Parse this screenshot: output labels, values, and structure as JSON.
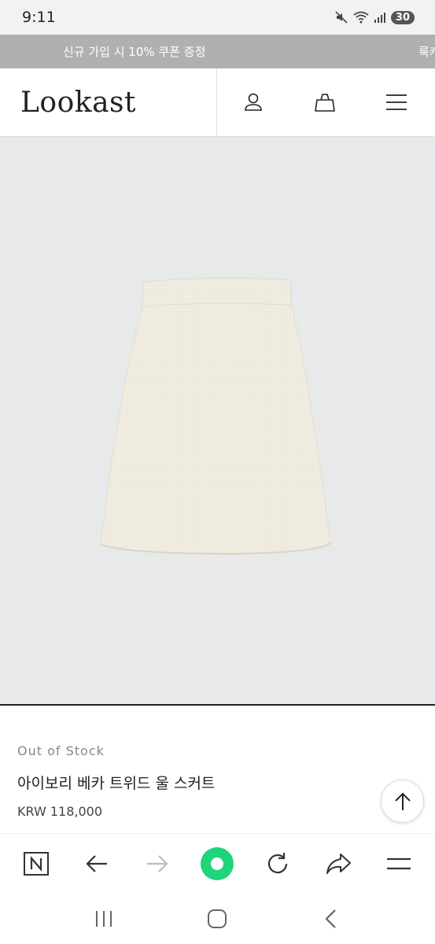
{
  "status_bar": {
    "time": "9:11",
    "battery": "30"
  },
  "promo": {
    "text": "신규 가입 시 10% 쿠폰 증정",
    "text_next": "룩캐"
  },
  "header": {
    "logo": "Lookast"
  },
  "product": {
    "stock_status": "Out of Stock",
    "name": "아이보리 베카 트위드 울 스커트",
    "price": "KRW 118,000"
  },
  "colors": {
    "promo_bg": "#b0b0b0",
    "image_bg": "#e8e9ea",
    "skirt": "#efece0",
    "home_accent": "#1fd47a"
  },
  "icons": {
    "header": [
      "user-icon",
      "shopping-bag-icon",
      "menu-icon"
    ],
    "browser": [
      "naver-n-icon",
      "back-arrow-icon",
      "forward-arrow-icon",
      "home-green-icon",
      "refresh-icon",
      "share-icon",
      "browser-menu-icon"
    ],
    "system": [
      "recent-apps-icon",
      "home-icon",
      "back-icon"
    ]
  }
}
